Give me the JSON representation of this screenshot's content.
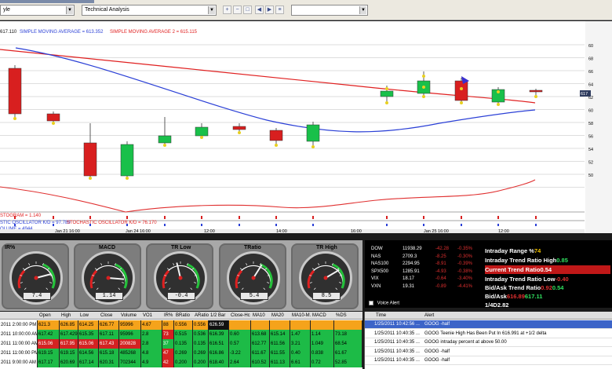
{
  "toolbar": {
    "left_select_value": "yle",
    "study_select_value": "Technical Analysis"
  },
  "chart": {
    "legend": {
      "price": "617.110",
      "sma1": "SIMPLE MOVING AVERAGE = 613.352",
      "sma2": "SIMPLE MOVING AVERAGE 2 = 615.115",
      "stoch_hist": "STOGRAM = 1.140",
      "stoch_osc": "STIC OSCILLATOR K/D = 97.789",
      "stoch_osc2": "STOCHASTIC OSCILLATOR K/D = 76.170",
      "volume": "OLUME = 4944"
    },
    "last_price_tag": "617",
    "y_ticks": [
      "60",
      "68",
      "66",
      "64",
      "62",
      "60",
      "58",
      "56",
      "54",
      "52",
      "50"
    ],
    "x_labels": [
      "Jan 21 16:00",
      "Jan 24 16:00",
      "12:00",
      "14:00",
      "16:00",
      "Jan 25 16:00",
      "12:00"
    ],
    "colors": {
      "up": "#19c04a",
      "down": "#d81f1f",
      "sma_red": "#e02020",
      "sma_blue": "#2a3fd6",
      "stoch_red": "#e03030"
    }
  },
  "chart_data": {
    "type": "candlestick",
    "candles": [
      {
        "dir": "down"
      },
      {
        "dir": "down"
      },
      {
        "dir": "down"
      },
      {
        "dir": "up"
      },
      {
        "dir": "up"
      },
      {
        "dir": "up"
      },
      {
        "dir": "down"
      },
      {
        "dir": "down"
      },
      {
        "dir": "up"
      },
      {
        "dir": "up"
      },
      {
        "dir": "up"
      },
      {
        "dir": "down"
      },
      {
        "dir": "up"
      },
      {
        "dir": "down"
      }
    ]
  },
  "gauges": [
    {
      "label": "IR%",
      "readout": "7.4",
      "needle": 0.78
    },
    {
      "label": "MACD",
      "readout": "1.14",
      "needle": 0.85
    },
    {
      "label": "TR Low",
      "readout": "-0.4",
      "needle": 0.45
    },
    {
      "label": "TRatio",
      "readout": "5.4",
      "needle": 0.62
    },
    {
      "label": "TR High",
      "readout": "8.5",
      "needle": 0.72
    }
  ],
  "markets": [
    {
      "sym": "DOW",
      "val": "11938.29",
      "chg": "-42.28",
      "pct": "-0.35%"
    },
    {
      "sym": "NAS",
      "val": "2709.3",
      "chg": "-8.25",
      "pct": "-0.30%"
    },
    {
      "sym": "NAS100",
      "val": "2294.95",
      "chg": "-8.91",
      "pct": "-0.39%"
    },
    {
      "sym": "SPX500",
      "val": "1285.91",
      "chg": "-4.93",
      "pct": "-0.38%"
    },
    {
      "sym": "VIX",
      "val": "18.17",
      "chg": "-0.64",
      "pct": "-3.40%"
    },
    {
      "sym": "VXN",
      "val": "19.31",
      "chg": "-0.89",
      "pct": "-4.41%"
    }
  ],
  "trend": {
    "intraday_range_label": "Intraday Range %",
    "intraday_range_value": "74",
    "trend_high_label": "Intraday Trend Ratio High",
    "trend_high_value": "0.85",
    "current_label": "Current Trend Ratio",
    "current_value": "0.54",
    "trend_low_label": "Intraday Trend Ratio Low",
    "trend_low_value": "-0.40",
    "bid_ask_ratio_label": "Bid/Ask Trend Ratio",
    "bid_ask_ratio_1": "0.92",
    "bid_ask_ratio_2": "0.54",
    "bid_ask_label": "Bid/Ask",
    "bid": "616.89",
    "ask": "617.11",
    "fourd_label": "1/4D",
    "fourd_value": "2.82"
  },
  "voice_alert_label": "Voice Alert",
  "table": {
    "headers": [
      "Open",
      "High",
      "Low",
      "Close",
      "Volume",
      "VO1",
      "IR%",
      "BRatio",
      "ARatio",
      "1/2 Bar",
      "Close-Hc",
      "MA10",
      "MA20",
      "MA10-M.",
      "MACD",
      "%DS"
    ],
    "rows": [
      {
        "time": "2011 2:00:00 PM",
        "cells": [
          "621.3",
          "626.85",
          "614.25",
          "626.77",
          "95996",
          "4.67",
          "88",
          "0.556",
          "0.556",
          "626.59",
          "",
          "",
          "",
          "",
          "",
          "",
          ""
        ],
        "style": "orange"
      },
      {
        "time": "2011 10:00:00 AM",
        "cells": [
          "617.42",
          "617.429",
          "615.35",
          "617.11",
          "95996",
          "2.8",
          "73",
          "0.515",
          "0.536",
          "616.39",
          "0.60",
          "613.68",
          "615.14",
          "1.47",
          "1.14",
          "73.18"
        ],
        "style": "green"
      },
      {
        "time": "2011 11:00:00 AM",
        "cells": [
          "615.06",
          "617.95",
          "615.06",
          "617.43",
          "200828",
          "2.8",
          "37",
          "0.135",
          "0.135",
          "616.51",
          "0.57",
          "612.77",
          "611.56",
          "3.21",
          "1.049",
          "68.54"
        ],
        "style": "redgreen"
      },
      {
        "time": "2011 11:00:00 PM",
        "cells": [
          "619.15",
          "619.15",
          "614.56",
          "615.18",
          "485268",
          "4.8",
          "47",
          "0.269",
          "0.269",
          "616.86",
          "-3.22",
          "611.67",
          "611.55",
          "0.40",
          "0.838",
          "61.67"
        ],
        "style": "green"
      },
      {
        "time": "2011 9:00:00 AM",
        "cells": [
          "617.17",
          "620.69",
          "617.14",
          "620.31",
          "702344",
          "4.9",
          "42",
          "0.200",
          "0.200",
          "618.40",
          "2.64",
          "610.52",
          "611.13",
          "6.61",
          "0.72",
          "52.85"
        ],
        "style": "green"
      }
    ]
  },
  "alerts": {
    "headers": [
      "Time",
      "Alert"
    ],
    "rows": [
      {
        "time": "1/25/2011 10:42:56 ...",
        "text": "GOOG -half",
        "sel": true
      },
      {
        "time": "1/25/2011 10:40:35 ...",
        "text": "GOOG Teenie High Has Been Put In 616.991 at +1/2 delta",
        "sel": false
      },
      {
        "time": "1/25/2011 10:40:35 ...",
        "text": "GOOG intraday percent at above 50.00",
        "sel": false
      },
      {
        "time": "1/25/2011 10:40:35 ...",
        "text": "GOOG -half",
        "sel": false
      },
      {
        "time": "1/25/2011 10:40:35 ...",
        "text": "GOOG -half",
        "sel": false
      }
    ]
  }
}
